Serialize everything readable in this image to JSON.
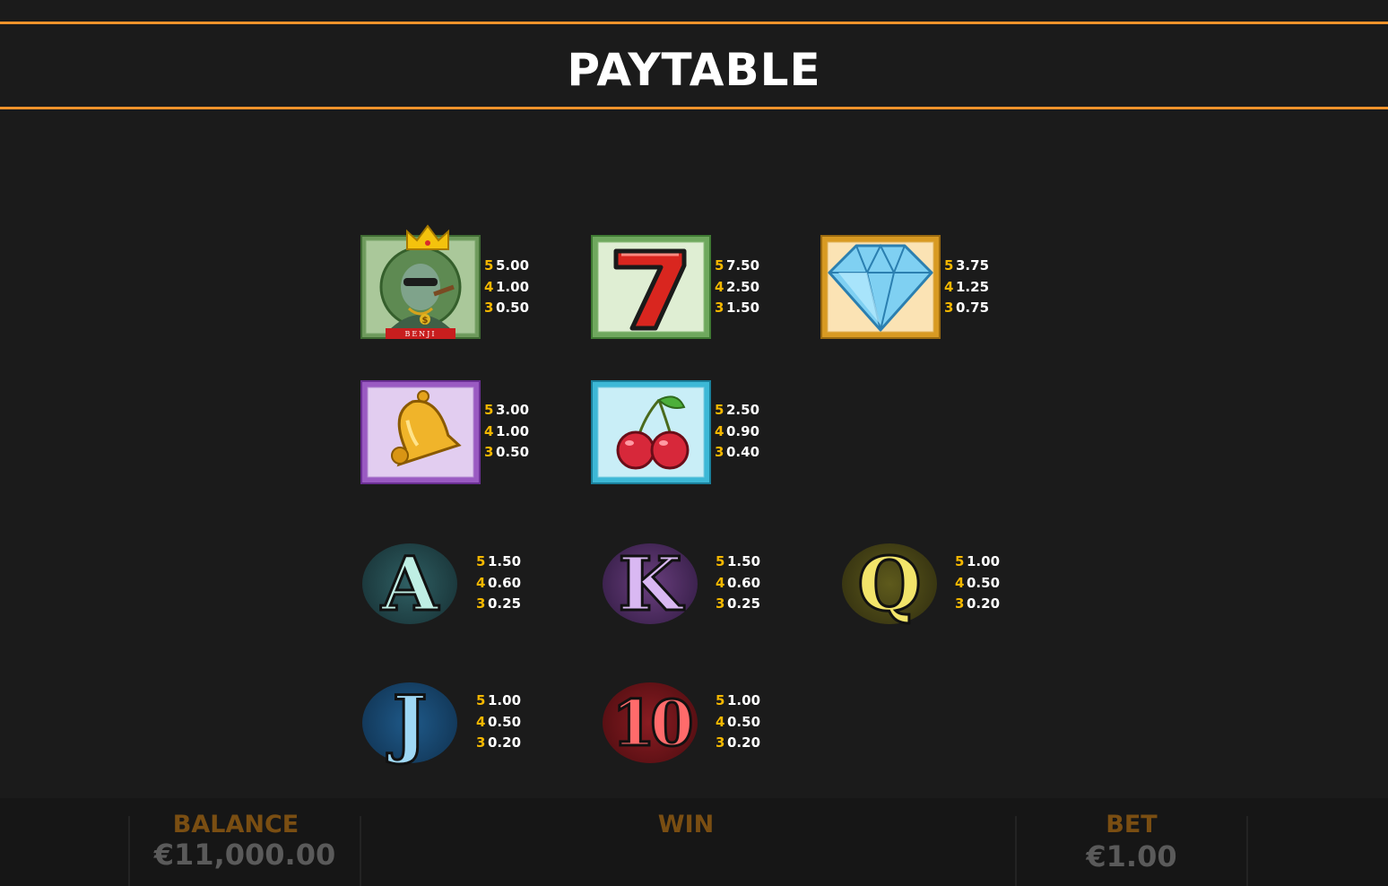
{
  "header": {
    "title": "PAYTABLE"
  },
  "colors": {
    "accent": "#f0932b",
    "multiplier": "#f5b800",
    "background": "#1b1b1b",
    "footer_label": "#7a4e12",
    "footer_value": "#5a5a5a"
  },
  "symbols": {
    "benji": {
      "icon": "benji-king-icon",
      "ribbon": "BENJI",
      "pays": [
        {
          "n": "5",
          "v": "5.00"
        },
        {
          "n": "4",
          "v": "1.00"
        },
        {
          "n": "3",
          "v": "0.50"
        }
      ]
    },
    "seven": {
      "icon": "lucky-seven-icon",
      "pays": [
        {
          "n": "5",
          "v": "7.50"
        },
        {
          "n": "4",
          "v": "2.50"
        },
        {
          "n": "3",
          "v": "1.50"
        }
      ]
    },
    "diamond": {
      "icon": "diamond-icon",
      "pays": [
        {
          "n": "5",
          "v": "3.75"
        },
        {
          "n": "4",
          "v": "1.25"
        },
        {
          "n": "3",
          "v": "0.75"
        }
      ]
    },
    "bell": {
      "icon": "bell-icon",
      "pays": [
        {
          "n": "5",
          "v": "3.00"
        },
        {
          "n": "4",
          "v": "1.00"
        },
        {
          "n": "3",
          "v": "0.50"
        }
      ]
    },
    "cherry": {
      "icon": "cherry-icon",
      "pays": [
        {
          "n": "5",
          "v": "2.50"
        },
        {
          "n": "4",
          "v": "0.90"
        },
        {
          "n": "3",
          "v": "0.40"
        }
      ]
    },
    "ace": {
      "glyph": "A",
      "pays": [
        {
          "n": "5",
          "v": "1.50"
        },
        {
          "n": "4",
          "v": "0.60"
        },
        {
          "n": "3",
          "v": "0.25"
        }
      ]
    },
    "king": {
      "glyph": "K",
      "pays": [
        {
          "n": "5",
          "v": "1.50"
        },
        {
          "n": "4",
          "v": "0.60"
        },
        {
          "n": "3",
          "v": "0.25"
        }
      ]
    },
    "queen": {
      "glyph": "Q",
      "pays": [
        {
          "n": "5",
          "v": "1.00"
        },
        {
          "n": "4",
          "v": "0.50"
        },
        {
          "n": "3",
          "v": "0.20"
        }
      ]
    },
    "jack": {
      "glyph": "J",
      "pays": [
        {
          "n": "5",
          "v": "1.00"
        },
        {
          "n": "4",
          "v": "0.50"
        },
        {
          "n": "3",
          "v": "0.20"
        }
      ]
    },
    "ten": {
      "glyph": "10",
      "pays": [
        {
          "n": "5",
          "v": "1.00"
        },
        {
          "n": "4",
          "v": "0.50"
        },
        {
          "n": "3",
          "v": "0.20"
        }
      ]
    }
  },
  "footer": {
    "balance_label": "BALANCE",
    "balance_value": "€11,000.00",
    "win_label": "WIN",
    "win_value": "",
    "bet_label": "BET",
    "bet_value": "€1.00"
  }
}
